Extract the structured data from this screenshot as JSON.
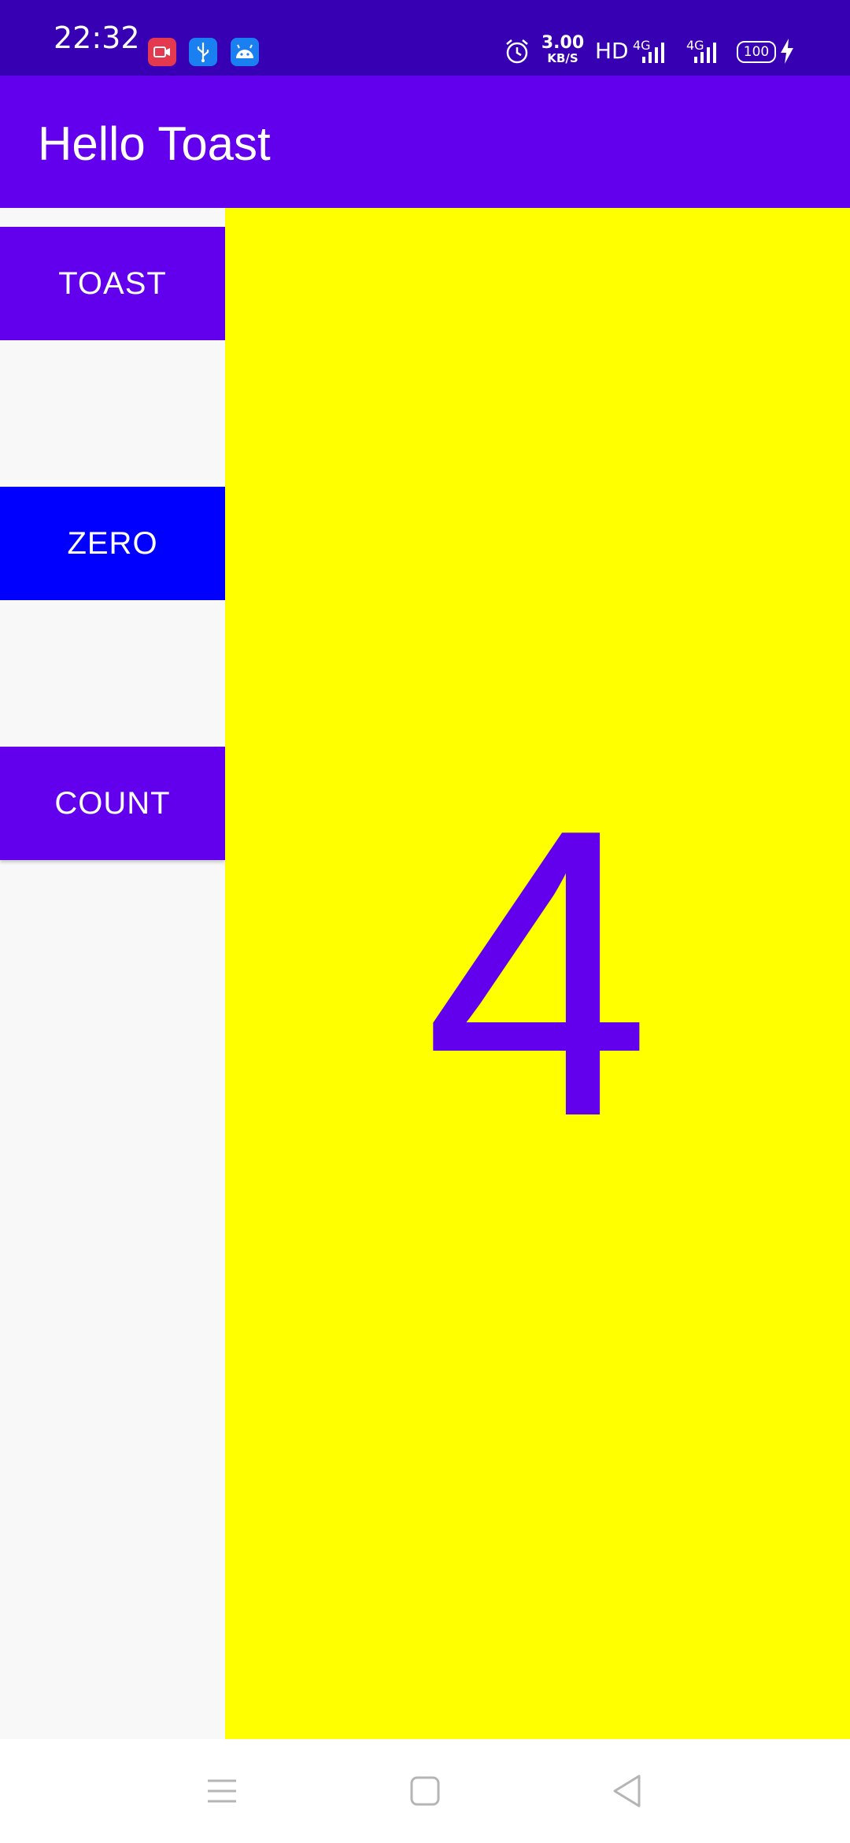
{
  "status_bar": {
    "time": "22:32",
    "net_speed_value": "3.00",
    "net_speed_unit": "KB/S",
    "hd_label": "HD",
    "network_1": "4G",
    "network_2": "4G",
    "battery": "100",
    "notification_icons": [
      "screen-record-icon",
      "usb-icon",
      "android-debug-icon"
    ],
    "colors": {
      "background": "#3700b3"
    }
  },
  "app_bar": {
    "title": "Hello Toast",
    "color": "#6200ee"
  },
  "buttons": {
    "toast_label": "TOAST",
    "zero_label": "ZERO",
    "count_label": "COUNT",
    "colors": {
      "toast": "#6200ee",
      "zero": "#0000ff",
      "count": "#6200ee"
    }
  },
  "counter": {
    "value": "4",
    "text_color": "#6200ee",
    "background": "#ffff00"
  },
  "nav_bar": {
    "icons": [
      "menu-icon",
      "home-icon",
      "back-icon"
    ]
  }
}
